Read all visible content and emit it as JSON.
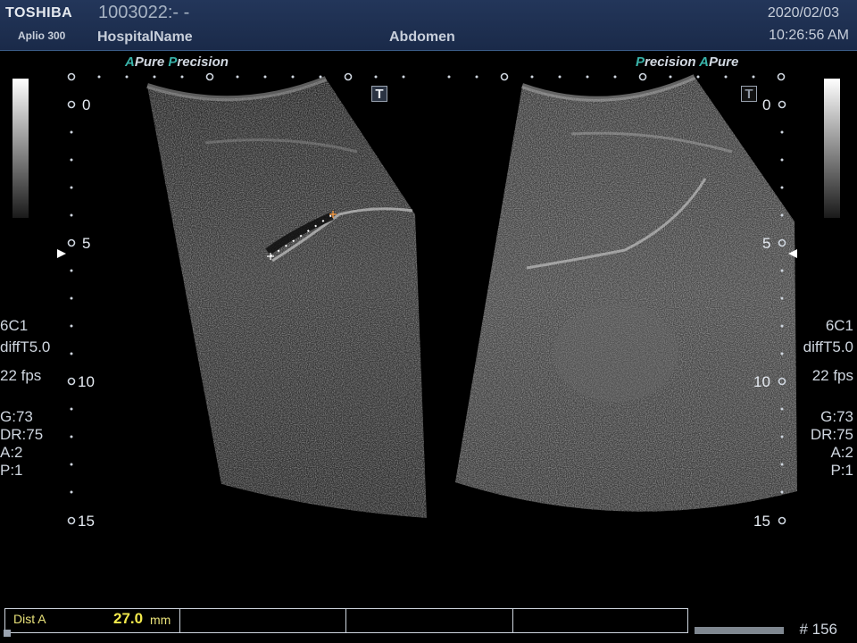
{
  "header": {
    "brand": "TOSHIBA",
    "model": "Aplio 300",
    "patient_id": "1003022:- -",
    "hospital": "HospitalName",
    "exam": "Abdomen",
    "date": "2020/02/03",
    "time": "10:26:56 AM"
  },
  "tech_left": {
    "a": "A",
    "pure": "Pure",
    "p": "P",
    "precision": "recision"
  },
  "tech_right": {
    "p": "P",
    "precision": "recision",
    "a": "A",
    "pure": "Pure"
  },
  "depth_scale": {
    "d0": "0",
    "d5": "5",
    "d10": "10",
    "d15": "15"
  },
  "params": {
    "probe": "6C1",
    "mode": "diffT5.0",
    "fps": "22 fps",
    "gain": "G:73",
    "dynamic_range": "DR:75",
    "a": "A:2",
    "p": "P:1"
  },
  "t_marker": "T",
  "measurement": {
    "label": "Dist A",
    "value": "27.0",
    "unit": "mm"
  },
  "frame_number": "# 156",
  "colors": {
    "header_bg": "#1f3152",
    "accent": "#39b3a9",
    "measure": "#f2e94c"
  }
}
